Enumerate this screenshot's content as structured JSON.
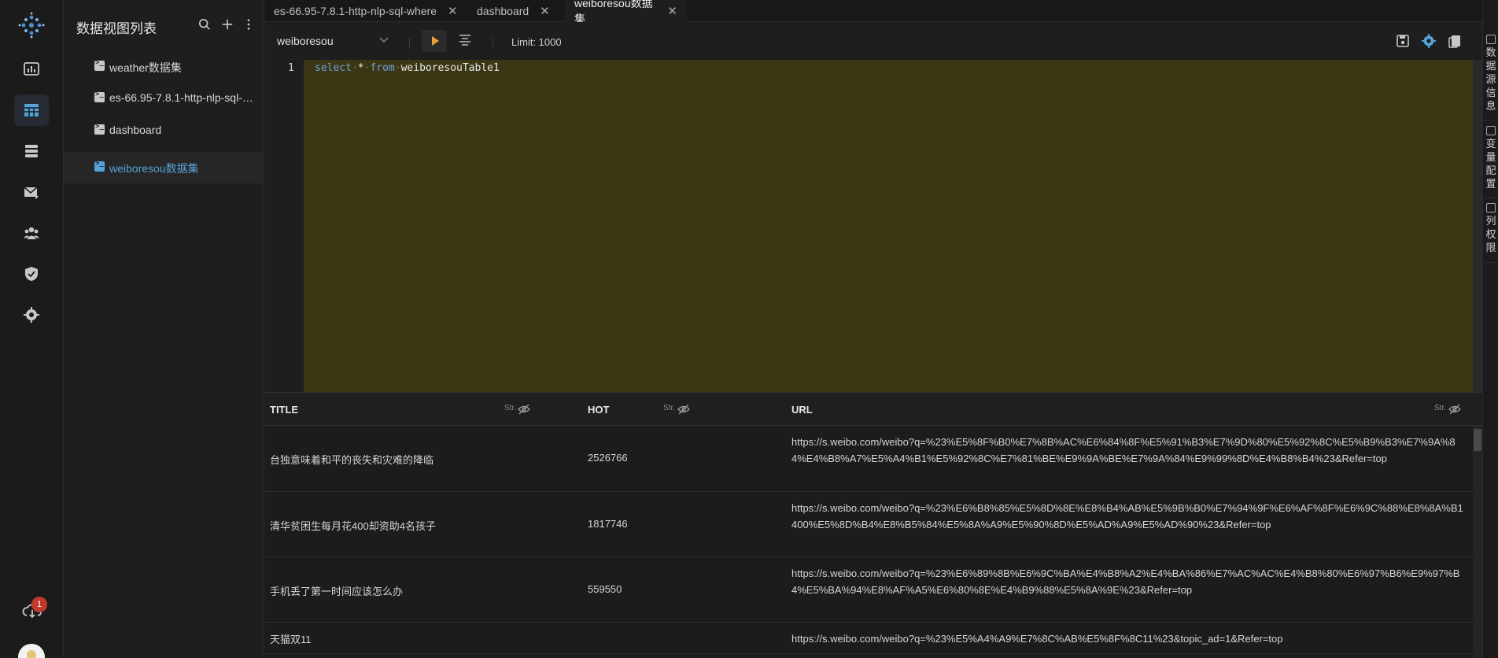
{
  "sidebar": {
    "title": "数据视图列表",
    "items": [
      {
        "label": "weather数据集"
      },
      {
        "label": "es-66.95-7.8.1-http-nlp-sql-where"
      },
      {
        "label": "dashboard"
      },
      {
        "label": "weiboresou数据集"
      }
    ]
  },
  "rail": {
    "notification_count": "1"
  },
  "tabs": [
    {
      "label": "es-66.95-7.8.1-http-nlp-sql-where"
    },
    {
      "label": "dashboard"
    },
    {
      "label": "weiboresou数据集"
    }
  ],
  "toolbar": {
    "source": "weiboresou",
    "limit": "Limit: 1000"
  },
  "editor": {
    "line_number": "1",
    "kw_select": "select",
    "star": "*",
    "kw_from": "from",
    "table": "weiboresouTable1"
  },
  "grid": {
    "columns": [
      {
        "name": "TITLE",
        "type": "Str."
      },
      {
        "name": "HOT",
        "type": "Str."
      },
      {
        "name": "URL",
        "type": "Str."
      }
    ],
    "rows": [
      {
        "title": "台独意味着和平的丧失和灾难的降临",
        "hot": "2526766",
        "url": "https://s.weibo.com/weibo?q=%23%E5%8F%B0%E7%8B%AC%E6%84%8F%E5%91%B3%E7%9D%80%E5%92%8C%E5%B9%B3%E7%9A%84%E4%B8%A7%E5%A4%B1%E5%92%8C%E7%81%BE%E9%9A%BE%E7%9A%84%E9%99%8D%E4%B8%B4%23&Refer=top"
      },
      {
        "title": "清华贫困生每月花400却资助4名孩子",
        "hot": "1817746",
        "url": "https://s.weibo.com/weibo?q=%23%E6%B8%85%E5%8D%8E%E8%B4%AB%E5%9B%B0%E7%94%9F%E6%AF%8F%E6%9C%88%E8%8A%B1400%E5%8D%B4%E8%B5%84%E5%8A%A9%E5%90%8D%E5%AD%A9%E5%AD%90%23&Refer=top"
      },
      {
        "title": "手机丢了第一时间应该怎么办",
        "hot": "559550",
        "url": "https://s.weibo.com/weibo?q=%23%E6%89%8B%E6%9C%BA%E4%B8%A2%E4%BA%86%E7%AC%AC%E4%B8%80%E6%97%B6%E9%97%B4%E5%BA%94%E8%AF%A5%E6%80%8E%E4%B9%88%E5%8A%9E%23&Refer=top"
      },
      {
        "title": "天猫双11",
        "hot": "",
        "url": "https://s.weibo.com/weibo?q=%23%E5%A4%A9%E7%8C%AB%E5%8F%8C11%23&topic_ad=1&Refer=top"
      }
    ]
  },
  "right_panel": {
    "sections": [
      {
        "label": "数据源信息"
      },
      {
        "label": "变量配置"
      },
      {
        "label": "列权限"
      }
    ]
  },
  "colors": {
    "accent": "#56a3d9",
    "run": "#e8a23a",
    "editor_bg": "#3b3714",
    "badge": "#c0392b"
  }
}
